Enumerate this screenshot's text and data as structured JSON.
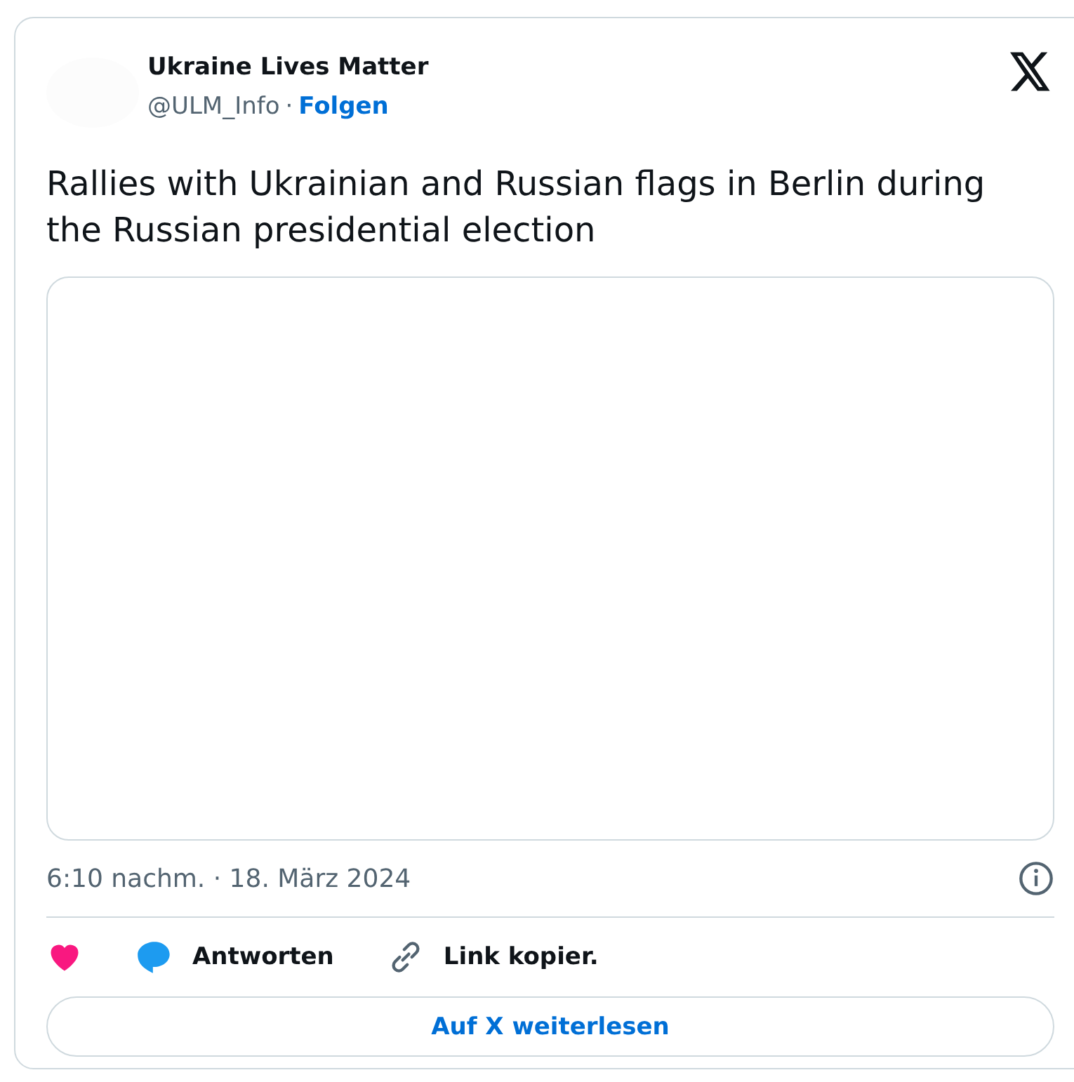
{
  "author": {
    "name": "Ukraine Lives Matter",
    "handle": "@ULM_Info",
    "separator": "·",
    "follow": "Folgen"
  },
  "text": "Rallies with Ukrainian and Russian flags in Berlin during the Russian presidential election",
  "media": {
    "kind": "empty"
  },
  "timestamp": "6:10 nachm. · 18. März 2024",
  "actions": [
    {
      "kind": "like"
    },
    {
      "kind": "reply",
      "label": "Antworten"
    },
    {
      "kind": "copy_link",
      "label": "Link kopier."
    }
  ],
  "read_more": "Auf X weiterlesen"
}
